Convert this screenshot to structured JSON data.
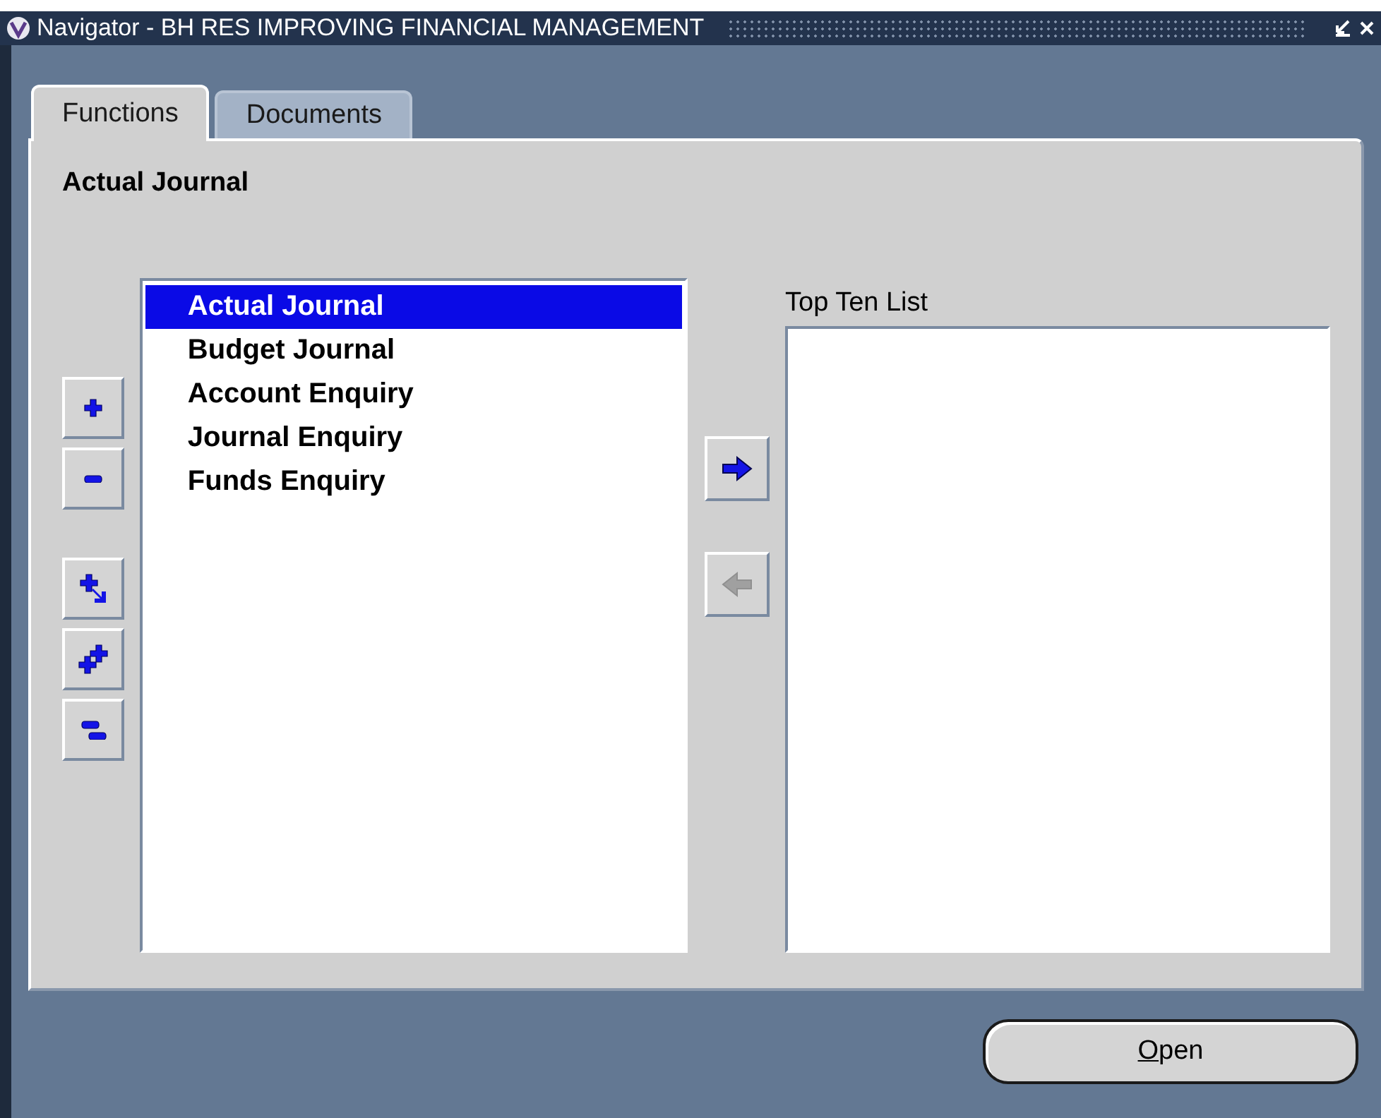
{
  "window": {
    "title": "Navigator - BH RES IMPROVING FINANCIAL MANAGEMENT"
  },
  "tabs": [
    {
      "label": "Functions",
      "selected": true
    },
    {
      "label": "Documents",
      "selected": false
    }
  ],
  "heading": "Actual Journal",
  "functions": [
    {
      "label": "Actual Journal",
      "selected": true
    },
    {
      "label": "Budget Journal",
      "selected": false
    },
    {
      "label": "Account Enquiry",
      "selected": false
    },
    {
      "label": "Journal Enquiry",
      "selected": false
    },
    {
      "label": "Funds Enquiry",
      "selected": false
    }
  ],
  "tree_buttons": [
    {
      "kind": "expand"
    },
    {
      "kind": "collapse"
    },
    {
      "kind": "expand-branch"
    },
    {
      "kind": "expand-all"
    },
    {
      "kind": "collapse-all"
    }
  ],
  "transfer_buttons": [
    {
      "kind": "add",
      "disabled": false
    },
    {
      "kind": "remove",
      "disabled": true
    }
  ],
  "top_ten": {
    "label": "Top Ten List"
  },
  "open_button": "Open"
}
